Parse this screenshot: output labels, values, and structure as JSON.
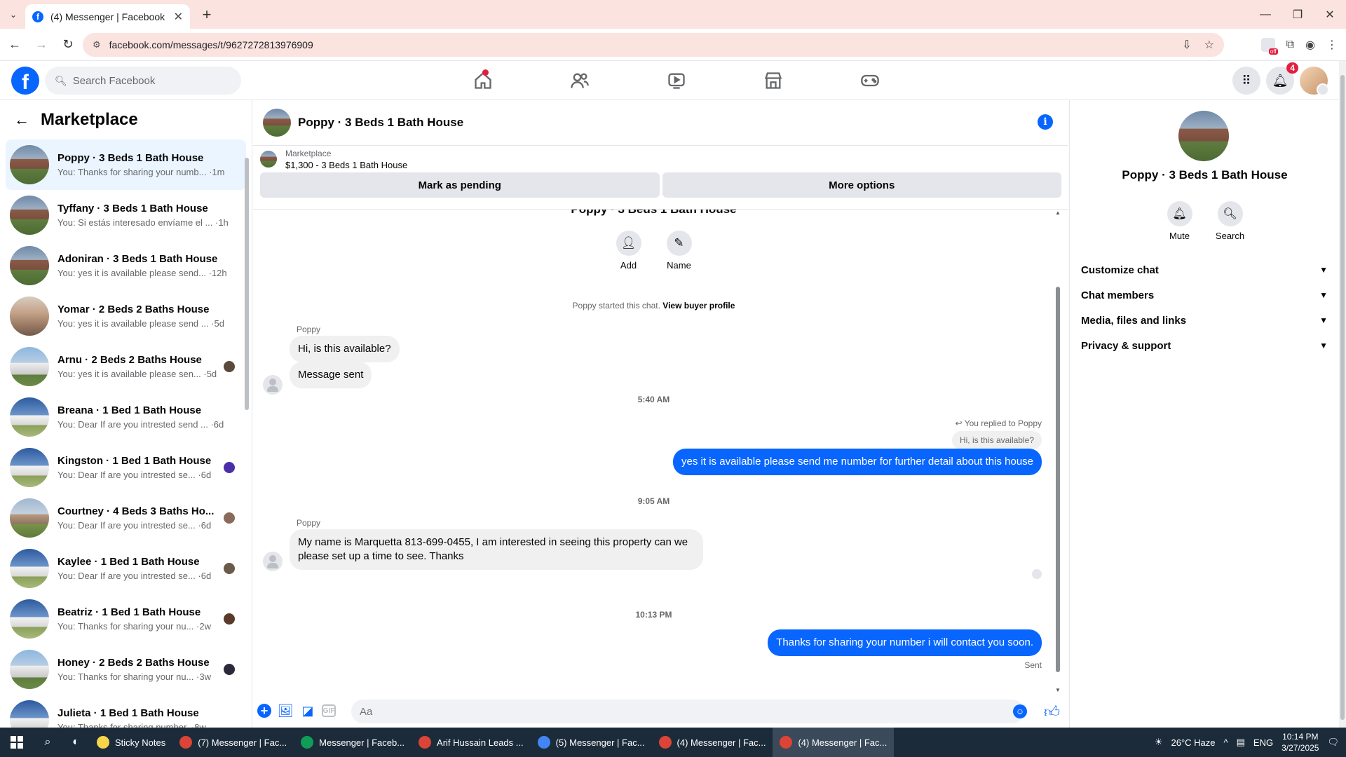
{
  "browser": {
    "tab_title": "(4) Messenger | Facebook",
    "url": "facebook.com/messages/t/9627272813976909"
  },
  "fb": {
    "search_placeholder": "Search Facebook",
    "notification_count": "4"
  },
  "sidebar": {
    "title": "Marketplace",
    "conversations": [
      {
        "name": "Poppy · 3 Beds 1 Bath House",
        "preview": "You: Thanks for sharing your numb... ·1m",
        "thumb": "house-a",
        "active": true
      },
      {
        "name": "Tyffany · 3 Beds 1 Bath House",
        "preview": "You: Si estás interesado envíame el ... ·1h",
        "thumb": "house-a"
      },
      {
        "name": "Adoniran · 3 Beds 1 Bath House",
        "preview": "You: yes it is available please send... ·12h",
        "thumb": "house-a"
      },
      {
        "name": "Yomar · 2 Beds 2 Baths House",
        "preview": "You: yes it is available please send ... ·5d",
        "thumb": "house-b"
      },
      {
        "name": "Arnu · 2 Beds 2 Baths House",
        "preview": "You: yes it is available please sen... ·5d",
        "thumb": "house-c"
      },
      {
        "name": "Breana · 1 Bed 1 Bath House",
        "preview": "You: Dear If are you intrested send ... ·6d",
        "thumb": "house-d"
      },
      {
        "name": "Kingston · 1 Bed 1 Bath House",
        "preview": "You: Dear If are you intrested se... ·6d",
        "thumb": "house-d"
      },
      {
        "name": "Courtney · 4 Beds 3 Baths Ho...",
        "preview": "You: Dear If are you intrested se... ·6d",
        "thumb": "house-e"
      },
      {
        "name": "Kaylee · 1 Bed 1 Bath House",
        "preview": "You: Dear If are you intrested se... ·6d",
        "thumb": "house-d"
      },
      {
        "name": "Beatriz · 1 Bed 1 Bath House",
        "preview": "You: Thanks for sharing your nu... ·2w",
        "thumb": "house-d"
      },
      {
        "name": "Honey · 2 Beds 2 Baths House",
        "preview": "You: Thanks for sharing your nu... ·3w",
        "thumb": "house-c"
      },
      {
        "name": "Julieta · 1 Bed 1 Bath House",
        "preview": "You: Thanks for sharing number. ·8w",
        "thumb": "house-d"
      }
    ]
  },
  "chat": {
    "title": "Poppy · 3 Beds 1 Bath House",
    "listing_label": "Marketplace",
    "listing_price": "$1,300 - 3 Beds 1 Bath House",
    "mark_pending": "Mark as pending",
    "more_options": "More options",
    "add_label": "Add",
    "name_label": "Name",
    "started_prefix": "Poppy started this chat.",
    "view_profile": "View buyer profile",
    "sender": "Poppy",
    "msg1": "Hi, is this available?",
    "msg2": "Message sent",
    "time1": "5:40 AM",
    "replied_to": "You replied to Poppy",
    "quoted": "Hi, is this available?",
    "msg3": "yes it is available please send me number for further detail about this house",
    "time2": "9:05 AM",
    "msg4": "My name is Marquetta 813-699-0455, I am interested in seeing this property can we please set up a time to see. Thanks",
    "time3": "10:13 PM",
    "msg5": "Thanks for sharing your number i will contact you soon.",
    "sent": "Sent",
    "composer_placeholder": "Aa"
  },
  "right_panel": {
    "title": "Poppy · 3 Beds 1 Bath House",
    "mute": "Mute",
    "search": "Search",
    "sections": [
      "Customize chat",
      "Chat members",
      "Media, files and links",
      "Privacy & support"
    ]
  },
  "taskbar": {
    "apps": [
      {
        "label": "Sticky Notes",
        "color": "#f7d54a"
      },
      {
        "label": "(7) Messenger | Fac...",
        "color": "#db4437"
      },
      {
        "label": "Messenger | Faceb...",
        "color": "#0f9d58"
      },
      {
        "label": "Arif Hussain Leads ...",
        "color": "#db4437"
      },
      {
        "label": "(5) Messenger | Fac...",
        "color": "#4285f4"
      },
      {
        "label": "(4) Messenger | Fac...",
        "color": "#db4437"
      },
      {
        "label": "(4) Messenger | Fac...",
        "color": "#db4437",
        "active": true
      }
    ],
    "weather": "26°C Haze",
    "lang": "ENG",
    "time": "10:14 PM",
    "date": "3/27/2025"
  }
}
